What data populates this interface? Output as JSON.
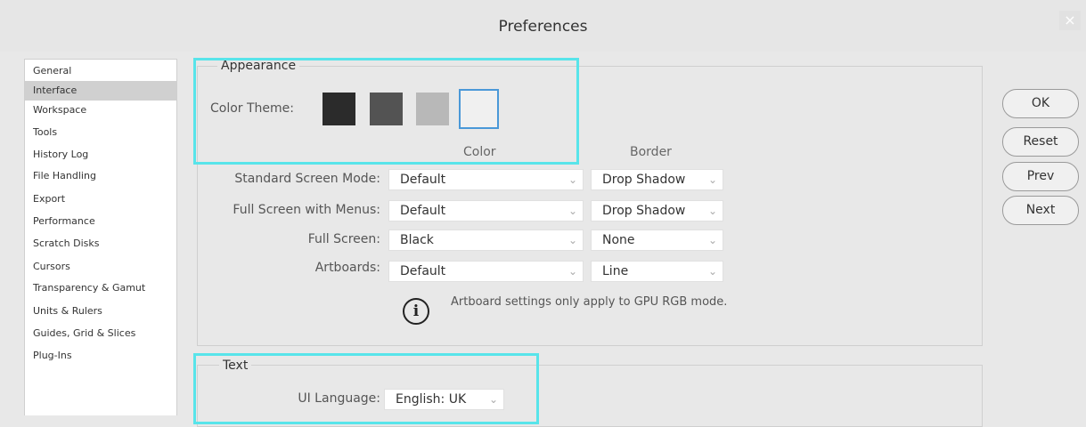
{
  "window": {
    "title": "Preferences",
    "close_glyph": "×"
  },
  "sidebar": {
    "items": [
      {
        "label": "General"
      },
      {
        "label": "Interface"
      },
      {
        "label": "Workspace"
      },
      {
        "label": "Tools"
      },
      {
        "label": "History Log"
      },
      {
        "label": "File Handling"
      },
      {
        "label": "Export"
      },
      {
        "label": "Performance"
      },
      {
        "label": "Scratch Disks"
      },
      {
        "label": "Cursors"
      },
      {
        "label": "Transparency & Gamut"
      },
      {
        "label": "Units & Rulers"
      },
      {
        "label": "Guides, Grid & Slices"
      },
      {
        "label": "Plug-Ins"
      }
    ],
    "selected": "Interface"
  },
  "appearance": {
    "legend": "Appearance",
    "color_theme_label": "Color Theme:",
    "themes": [
      "#2b2b2b",
      "#535353",
      "#b8b8b8",
      "#f0f0f0"
    ],
    "selected_theme": 3,
    "col_color": "Color",
    "col_border": "Border",
    "rows": [
      {
        "label": "Standard Screen Mode:",
        "color": "Default",
        "border": "Drop Shadow"
      },
      {
        "label": "Full Screen with Menus:",
        "color": "Default",
        "border": "Drop Shadow"
      },
      {
        "label": "Full Screen:",
        "color": "Black",
        "border": "None"
      },
      {
        "label": "Artboards:",
        "color": "Default",
        "border": "Line"
      }
    ],
    "note": "Artboard settings only apply to GPU RGB mode.",
    "info_glyph": "i"
  },
  "text_group": {
    "legend": "Text",
    "ui_language_label": "UI Language:",
    "ui_language_value": "English: UK"
  },
  "buttons": {
    "ok": "OK",
    "reset": "Reset",
    "prev": "Prev",
    "next": "Next"
  },
  "chevron_glyph": "⌄",
  "colors": {
    "highlight": "#58e4ea",
    "selected_item": "#d0d0d0"
  }
}
